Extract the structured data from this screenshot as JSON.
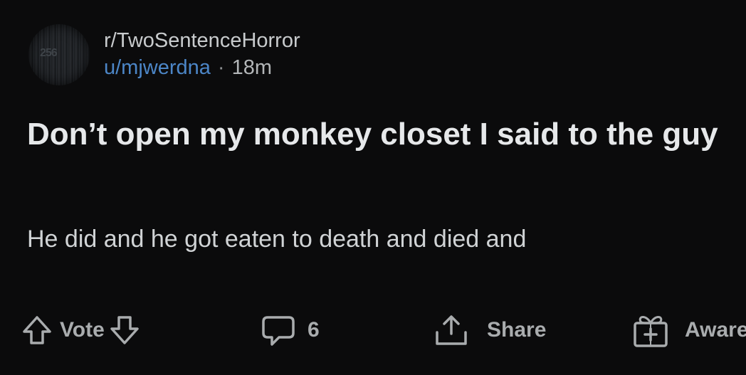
{
  "post": {
    "subreddit": "r/TwoSentenceHorror",
    "avatar_text": "256",
    "username": "u/mjwerdna",
    "separator": "·",
    "time": "18m",
    "title": "Don’t open my monkey closet I said to the guy",
    "body": "He did and he got eaten to death and died and"
  },
  "actions": {
    "vote_label": "Vote",
    "comment_count": "6",
    "share_label": "Share",
    "award_label": "Aware"
  },
  "icons": {
    "upvote": "upvote-arrow-icon",
    "downvote": "downvote-arrow-icon",
    "comment": "comment-bubble-icon",
    "share": "share-icon",
    "award": "award-gift-icon"
  },
  "colors": {
    "background": "#0b0b0c",
    "username": "#4c86c7",
    "text": "#e6e8ea",
    "muted": "#a9acae"
  }
}
